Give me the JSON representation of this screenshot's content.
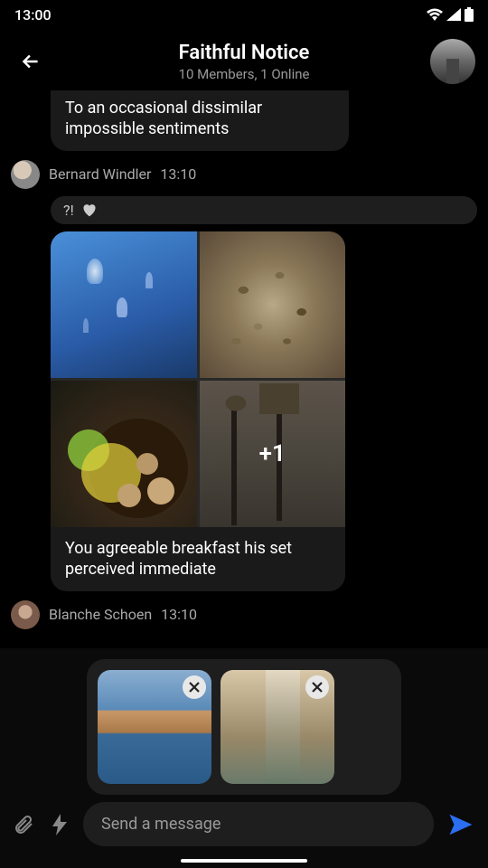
{
  "status": {
    "time": "13:00"
  },
  "header": {
    "title": "Faithful Notice",
    "subtitle": "10 Members, 1 Online"
  },
  "messages": [
    {
      "text": "To an occasional dissimilar impossible sentiments",
      "sender": "Bernard Windler",
      "time": "13:10",
      "reactions": {
        "text": "?!"
      }
    },
    {
      "media_overflow": "+1",
      "caption": "You agreeable breakfast his set perceived immediate",
      "sender": "Blanche Schoen",
      "time": "13:10"
    }
  ],
  "composer": {
    "placeholder": "Send a message"
  }
}
